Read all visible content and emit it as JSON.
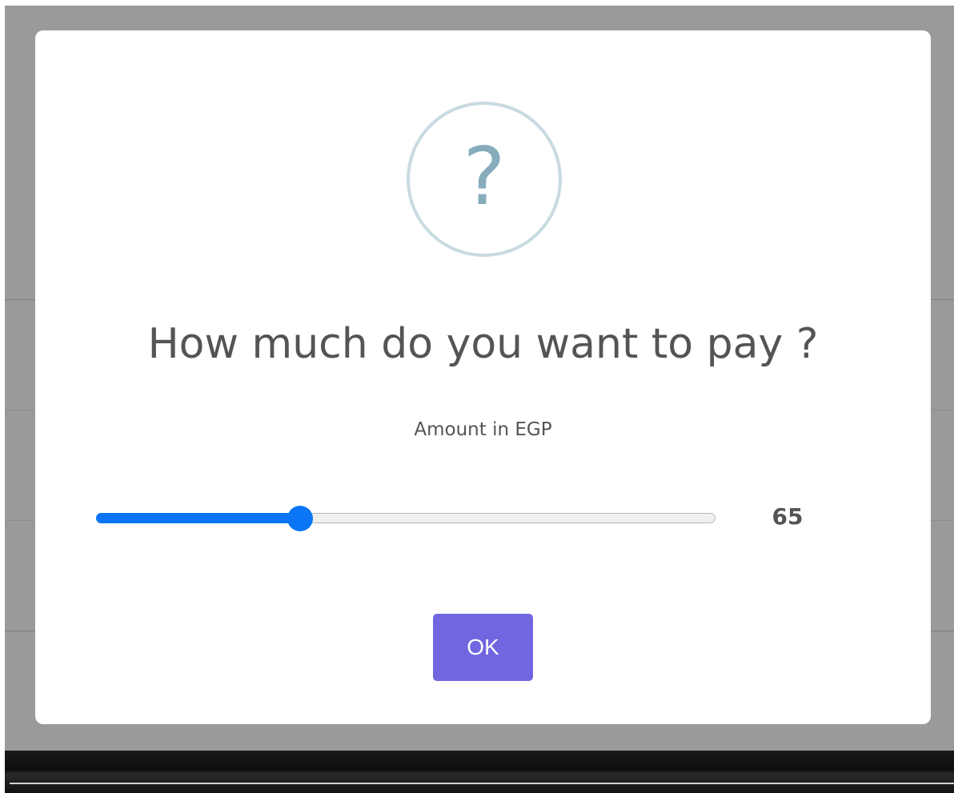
{
  "dialog": {
    "icon": "question-icon",
    "icon_glyph": "?",
    "title": "How much do you want to pay ?",
    "input_label": "Amount in EGP",
    "slider": {
      "value": 65,
      "value_text": "65",
      "fill_fraction": 0.33
    },
    "confirm_label": "OK"
  },
  "colors": {
    "overlay": "#9a9a9a",
    "icon_border": "#c9dae1",
    "icon_glyph": "#87adbd",
    "text": "#545454",
    "slider_accent": "#0a76f6",
    "confirm_button": "#7066e0"
  }
}
